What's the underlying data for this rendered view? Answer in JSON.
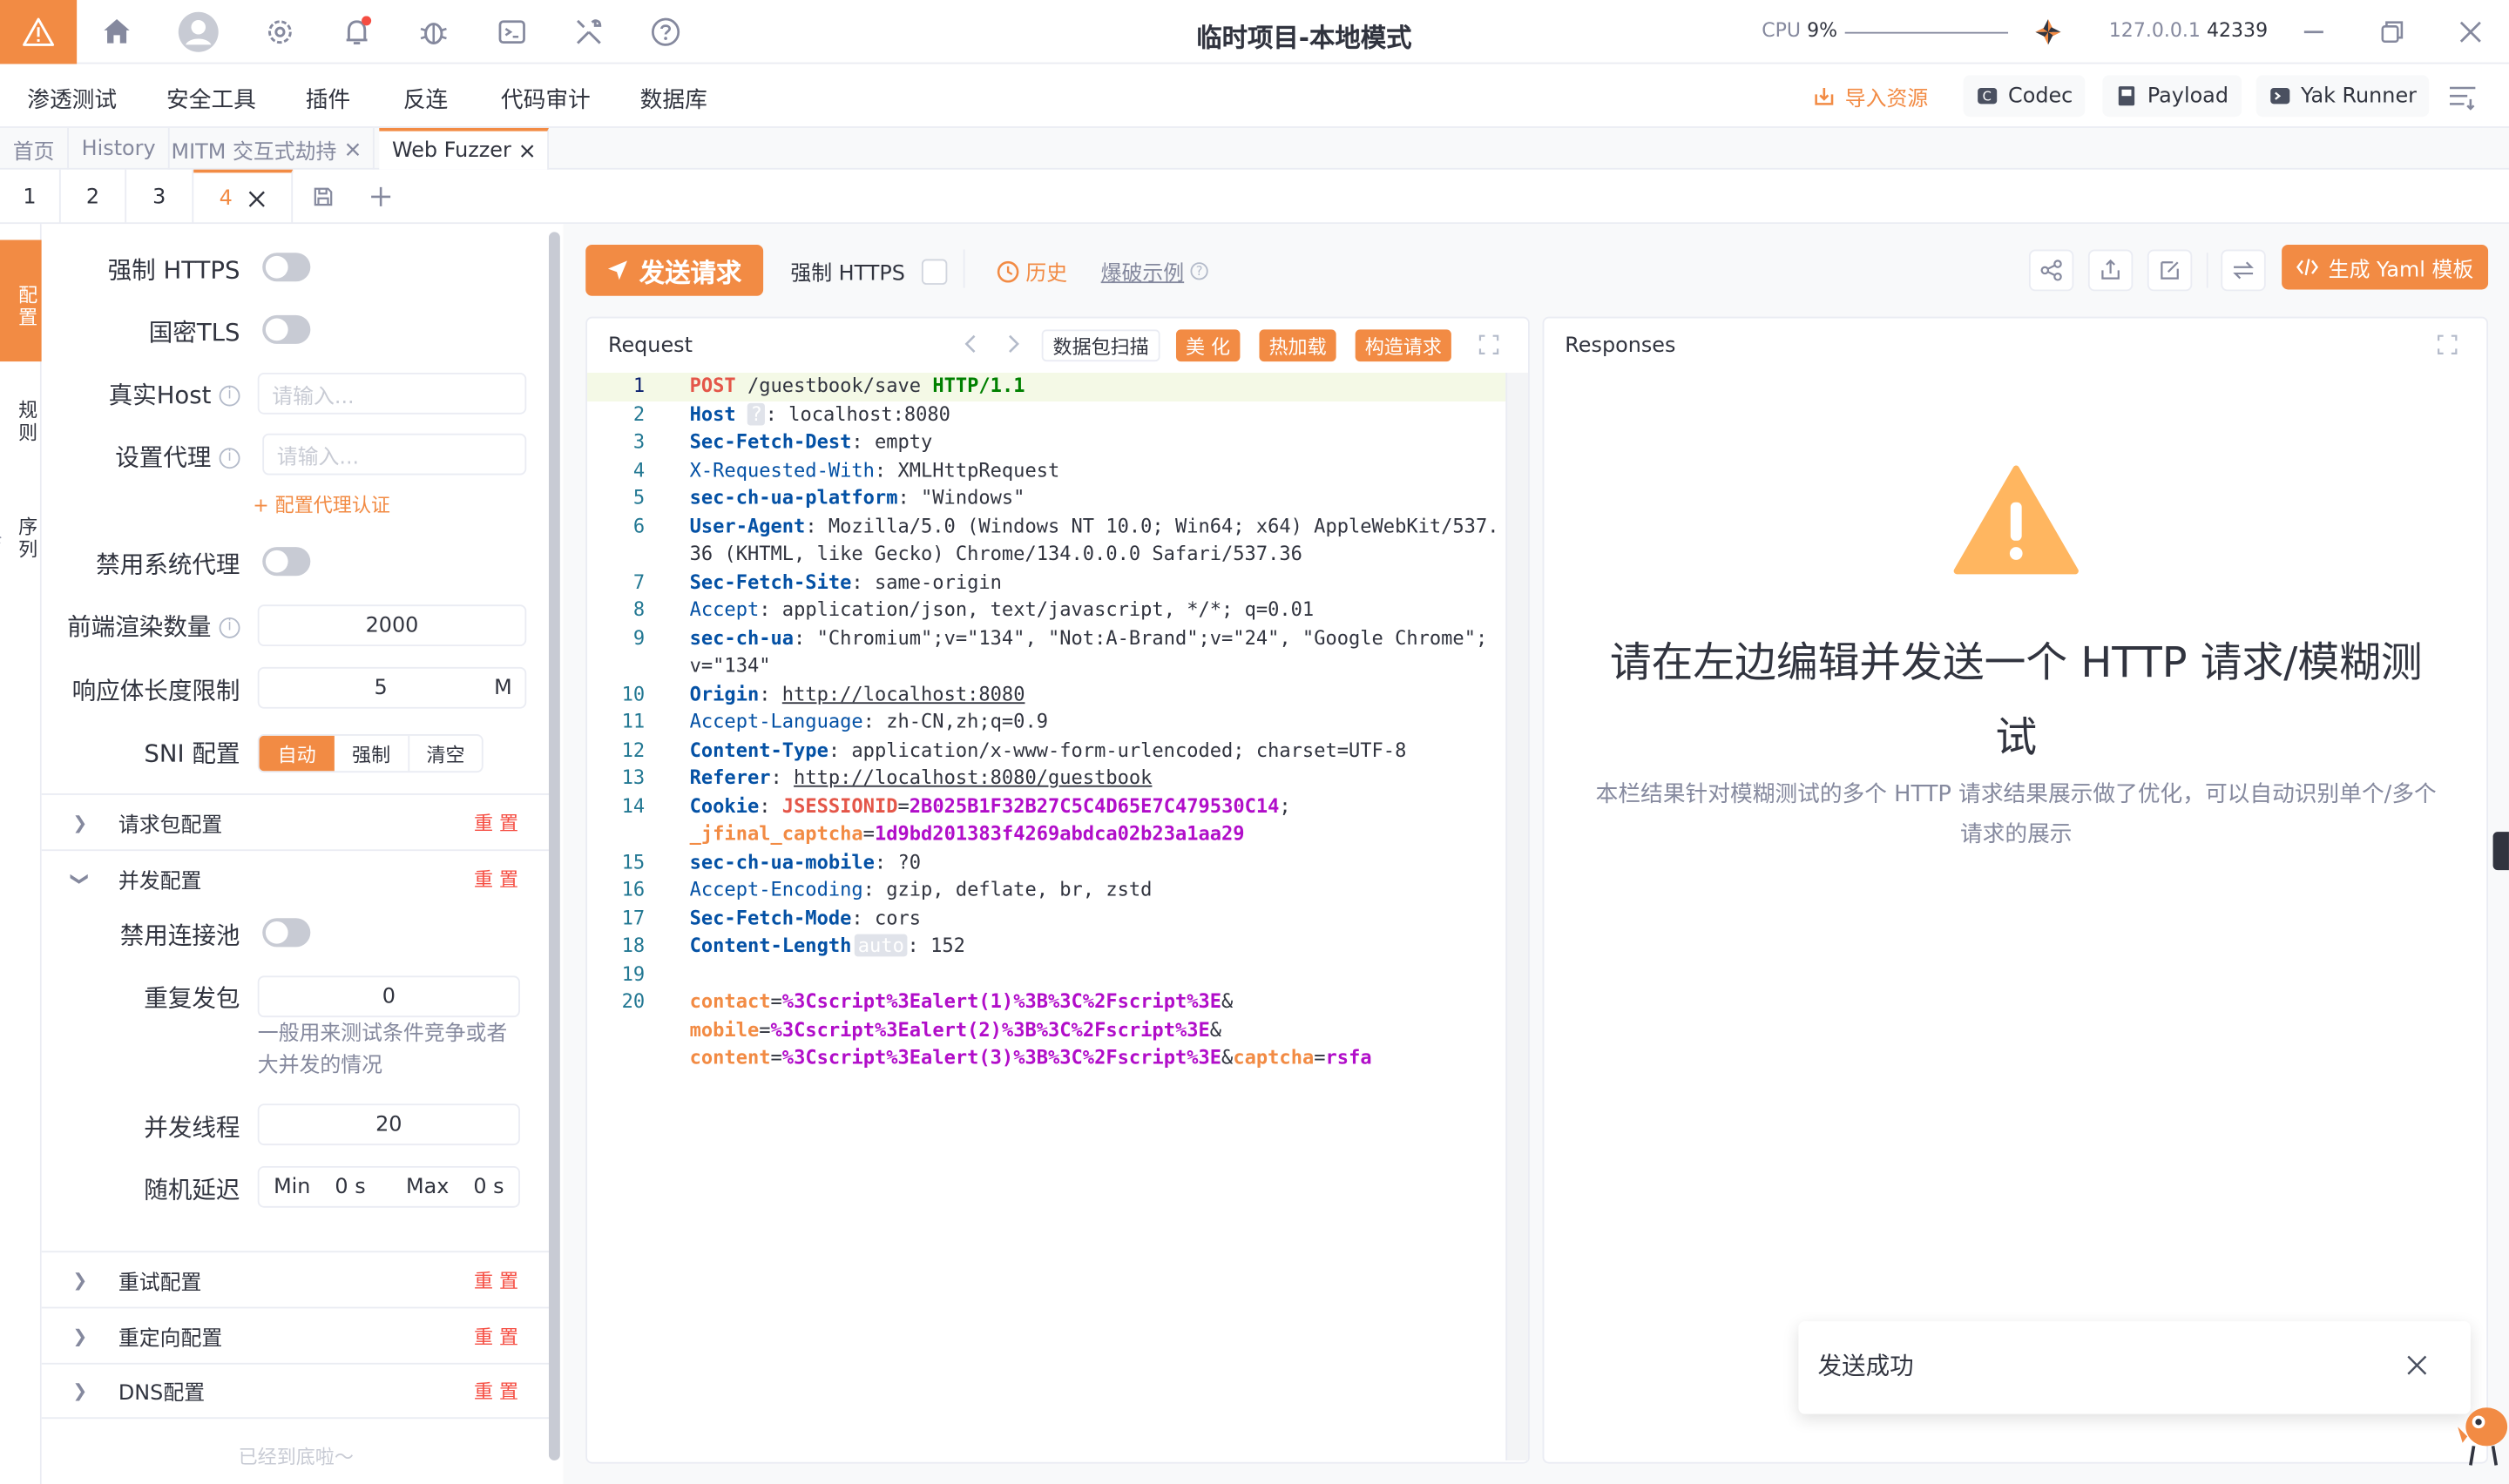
{
  "titlebar": {
    "title": "临时项目-本地模式",
    "cpu_label": "CPU",
    "cpu_value": "9%",
    "ip": "127.0.0.1",
    "port": "42339"
  },
  "menu": {
    "items": [
      "渗透测试",
      "安全工具",
      "插件",
      "反连",
      "代码审计",
      "数据库"
    ]
  },
  "top_actions": {
    "import": "导入资源",
    "codec": "Codec",
    "payload": "Payload",
    "yak_runner": "Yak Runner"
  },
  "tabs": [
    {
      "label": "首页"
    },
    {
      "label": "History"
    },
    {
      "label": "MITM 交互式劫持"
    },
    {
      "label": "Web Fuzzer"
    }
  ],
  "subtabs": [
    "1",
    "2",
    "3",
    "4"
  ],
  "rail": {
    "config": "配置",
    "rules": "规则",
    "sequence": "序列"
  },
  "config": {
    "force_https": "强制 HTTPS",
    "gm_tls": "国密TLS",
    "real_host": "真实Host",
    "real_host_placeholder": "请输入...",
    "proxy": "设置代理",
    "proxy_placeholder": "请输入...",
    "proxy_auth": "+ 配置代理认证",
    "disable_sys_proxy": "禁用系统代理",
    "render_count": "前端渲染数量",
    "render_count_value": "2000",
    "resp_limit": "响应体长度限制",
    "resp_limit_value": "5",
    "resp_limit_unit": "M",
    "sni": "SNI 配置",
    "sni_options": [
      "自动",
      "强制",
      "清空"
    ],
    "sections": {
      "req_pkg": "请求包配置",
      "concurrency": "并发配置",
      "retry": "重试配置",
      "redirect": "重定向配置",
      "dns": "DNS配置"
    },
    "reset": "重 置",
    "disable_pool": "禁用连接池",
    "repeat": "重复发包",
    "repeat_value": "0",
    "repeat_hint": "一般用来测试条件竞争或者大并发的情况",
    "threads": "并发线程",
    "threads_value": "20",
    "delay": "随机延迟",
    "delay_min": "Min",
    "delay_min_value": "0 s",
    "delay_max": "Max",
    "delay_max_value": "0 s",
    "bottom": "已经到底啦～"
  },
  "toolbar": {
    "send": "发送请求",
    "force_https": "强制 HTTPS",
    "history": "历史",
    "example": "爆破示例",
    "yaml": "生成 Yaml 模板"
  },
  "request": {
    "title": "Request",
    "scan": "数据包扫描",
    "beautify": "美 化",
    "hotload": "热加载",
    "build": "构造请求"
  },
  "response": {
    "title": "Responses",
    "heading": "请在左边编辑并发送一个 HTTP 请求/模糊测试",
    "desc": "本栏结果针对模糊测试的多个 HTTP 请求结果展示做了优化，可以自动识别单个/多个请求的展示"
  },
  "toast": {
    "text": "发送成功"
  },
  "code": {
    "l1": {
      "n": "1",
      "method": "POST",
      "path": "/guestbook/save",
      "proto": "HTTP/1.1"
    },
    "l2": {
      "n": "2",
      "key": "Host",
      "chip": "?",
      "val": "localhost:8080"
    },
    "l3": {
      "n": "3",
      "key": "Sec-Fetch-Dest",
      "val": "empty"
    },
    "l4": {
      "n": "4",
      "key": "X-Requested-With",
      "val": "XMLHttpRequest"
    },
    "l5": {
      "n": "5",
      "key": "sec-ch-ua-platform",
      "val": "\"Windows\""
    },
    "l6": {
      "n": "6",
      "key": "User-Agent",
      "val": "Mozilla/5.0 (Windows NT 10.0; Win64; x64) AppleWebKit/537.",
      "val2": "36 (KHTML, like Gecko) Chrome/134.0.0.0 Safari/537.36"
    },
    "l7": {
      "n": "7",
      "key": "Sec-Fetch-Site",
      "val": "same-origin"
    },
    "l8": {
      "n": "8",
      "key": "Accept",
      "val": "application/json, text/javascript, */*; q=0.01"
    },
    "l9": {
      "n": "9",
      "key": "sec-ch-ua",
      "val": "\"Chromium\";v=\"134\", \"Not:A-Brand\";v=\"24\", \"Google Chrome\";",
      "val2": "v=\"134\""
    },
    "l10": {
      "n": "10",
      "key": "Origin",
      "val": "http://localhost:8080"
    },
    "l11": {
      "n": "11",
      "key": "Accept-Language",
      "val": "zh-CN,zh;q=0.9"
    },
    "l12": {
      "n": "12",
      "key": "Content-Type",
      "val": "application/x-www-form-urlencoded; charset=UTF-8"
    },
    "l13": {
      "n": "13",
      "key": "Referer",
      "val": "http://localhost:8080/guestbook"
    },
    "l14": {
      "n": "14",
      "key": "Cookie",
      "c1k": "JSESSIONID",
      "c1v": "2B025B1F32B27C5C4D65E7C479530C14",
      "c2k": "_jfinal_captcha",
      "c2v": "1d9bd201383f4269abdca02b23a1aa29"
    },
    "l15": {
      "n": "15",
      "key": "sec-ch-ua-mobile",
      "val": "?0"
    },
    "l16": {
      "n": "16",
      "key": "Accept-Encoding",
      "val": "gzip, deflate, br, zstd"
    },
    "l17": {
      "n": "17",
      "key": "Sec-Fetch-Mode",
      "val": "cors"
    },
    "l18": {
      "n": "18",
      "key": "Content-Length",
      "chip": "auto",
      "val": "152"
    },
    "l19": {
      "n": "19"
    },
    "l20": {
      "n": "20",
      "b1k": "contact",
      "b1v": "%3Cscript%3Ealert(1)%3B%3C%2Fscript%3E",
      "b2k": "mobile",
      "b2v": "%3Cscript%3Ealert(2)%3B%3C%2Fscript%3E",
      "b3k": "content",
      "b3v": "%3Cscript%3Ealert(3)%3B%3C%2Fscript%3E",
      "b4k": "captcha",
      "b4v": "rsfa"
    }
  },
  "colors": {
    "accent": "#f28b44",
    "danger": "#f54d42"
  }
}
